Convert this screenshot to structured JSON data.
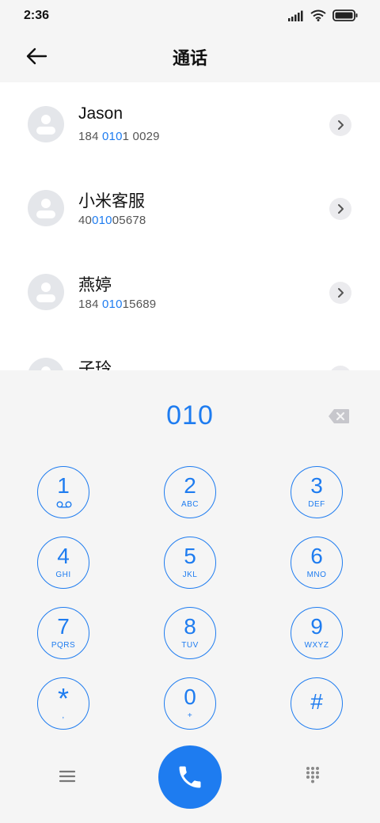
{
  "status": {
    "time": "2:36",
    "icons": [
      "signal-icon",
      "wifi-icon",
      "battery-icon"
    ]
  },
  "header": {
    "title": "通话",
    "back_icon": "back-arrow-icon"
  },
  "contacts": [
    {
      "name": "Jason",
      "number_parts": [
        "184 ",
        "010",
        "1 0029"
      ]
    },
    {
      "name": "小米客服",
      "number_parts": [
        "40",
        "010",
        "05678"
      ]
    },
    {
      "name": "燕婷",
      "number_parts": [
        "184 ",
        "010",
        "15689"
      ]
    },
    {
      "name": "子玲",
      "number_parts": [
        "",
        "",
        ""
      ]
    }
  ],
  "dialer": {
    "input": "010",
    "keys": [
      {
        "digit": "1",
        "letters": ""
      },
      {
        "digit": "2",
        "letters": "ABC"
      },
      {
        "digit": "3",
        "letters": "DEF"
      },
      {
        "digit": "4",
        "letters": "GHI"
      },
      {
        "digit": "5",
        "letters": "JKL"
      },
      {
        "digit": "6",
        "letters": "MNO"
      },
      {
        "digit": "7",
        "letters": "PQRS"
      },
      {
        "digit": "8",
        "letters": "TUV"
      },
      {
        "digit": "9",
        "letters": "WXYZ"
      },
      {
        "digit": "*",
        "letters": ","
      },
      {
        "digit": "0",
        "letters": "+"
      },
      {
        "digit": "#",
        "letters": ""
      }
    ]
  },
  "colors": {
    "accent": "#1e7cf0",
    "background": "#f5f5f5",
    "avatar": "#e4e6ea"
  }
}
